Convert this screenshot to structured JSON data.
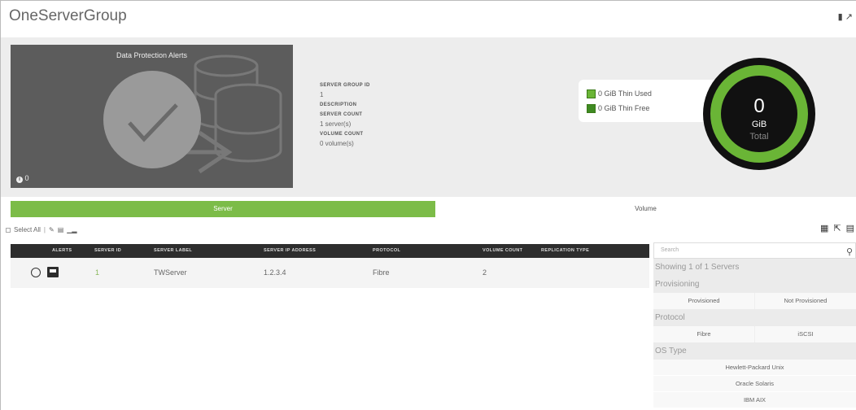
{
  "window": {
    "title": "OneServerGroup",
    "top_icons": "🗑 ✎"
  },
  "alerts": {
    "title": "Data Protection Alerts",
    "count": "0"
  },
  "details": {
    "group_id_label": "SERVER GROUP ID",
    "group_id_value": "1",
    "description_label": "DESCRIPTION",
    "server_count_label": "SERVER COUNT",
    "server_count_value": "1 server(s)",
    "volume_count_label": "VOLUME COUNT",
    "volume_count_value": "0 volume(s)"
  },
  "capacity": {
    "used_label": "0 GiB Thin Used",
    "free_label": "0 GiB Thin Free",
    "total_value": "0",
    "total_unit": "GiB",
    "total_label": "Total",
    "colors": {
      "used": "#6ab536",
      "free": "#3f8a22",
      "ring": "#6ab536"
    }
  },
  "tabs": [
    {
      "label": "Server",
      "active": true
    },
    {
      "label": "Volume",
      "active": false
    }
  ],
  "toolbar": {
    "select_all": "Select All"
  },
  "table": {
    "columns": [
      "ALERTS",
      "SERVER ID",
      "SERVER LABEL",
      "SERVER IP ADDRESS",
      "PROTOCOL",
      "VOLUME COUNT",
      "REPLICATION TYPE"
    ],
    "rows": [
      {
        "server_id": "1",
        "label": "TWServer",
        "ip": "1.2.3.4",
        "protocol": "Fibre",
        "volume_count": "2",
        "replication": ""
      }
    ]
  },
  "filters": {
    "search_placeholder": "Search",
    "showing": "Showing 1 of 1 Servers",
    "provisioning_label": "Provisioning",
    "provisioning_options": [
      "Provisioned",
      "Not Provisioned"
    ],
    "protocol_label": "Protocol",
    "protocol_options": [
      "Fibre",
      "iSCSI"
    ],
    "os_label": "OS Type",
    "os_options": [
      "Hewlett-Packard Unix",
      "Oracle Solaris",
      "IBM AIX"
    ]
  }
}
